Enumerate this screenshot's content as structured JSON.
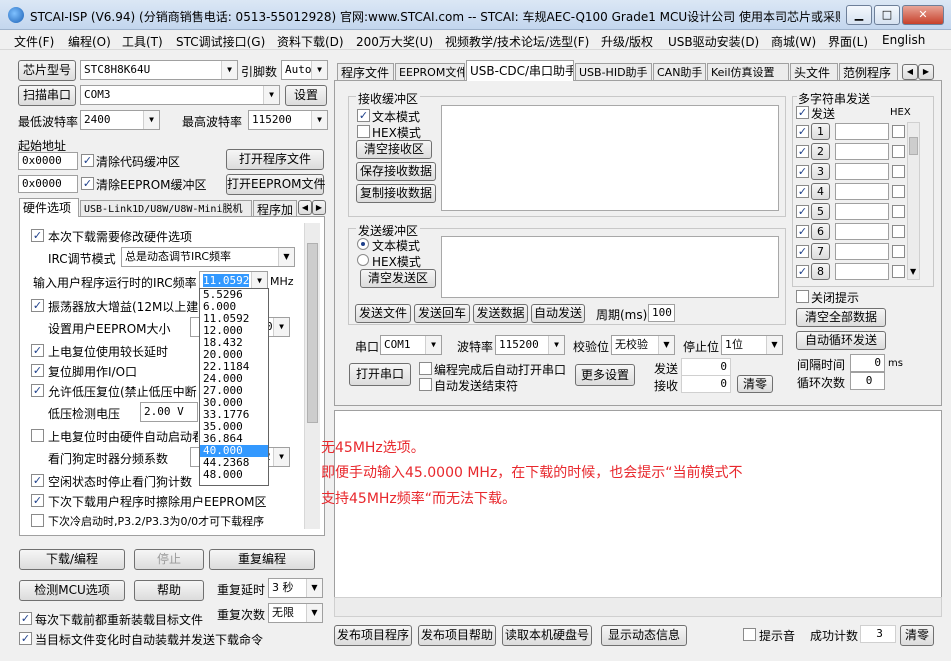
{
  "window": {
    "title": "STCAI-ISP (V6.94) (分销商销售电话: 0513-55012928) 官网:www.STCAI.com  -- STCAI: 车规AEC-Q100 Grade1 MCU设计公司 使用本司芯片或采购...",
    "min_glyph": "▁",
    "max_glyph": "□",
    "close_glyph": "✕"
  },
  "menu": [
    "文件(F)",
    "编程(O)",
    "工具(T)",
    "STC调试接口(G)",
    "资料下载(D)",
    "200万大奖(U)",
    "视频教学/技术论坛/选型(F)",
    "升级/版权",
    "USB驱动安装(D)",
    "商城(W)",
    "界面(L)",
    "English"
  ],
  "left": {
    "chip_model_btn": "芯片型号",
    "chip_model": "STC8H8K64U",
    "pin_label": "引脚数",
    "pin_value": "Auto",
    "scan_port_btn": "扫描串口",
    "port": "COM3",
    "settings_btn": "设置",
    "min_baud_label": "最低波特率",
    "min_baud": "2400",
    "max_baud_label": "最高波特率",
    "max_baud": "115200",
    "start_addr_label": "起始地址",
    "addr1": "0x0000",
    "clear_code_label": "清除代码缓冲区",
    "open_prog_btn": "打开程序文件",
    "addr2": "0x0000",
    "clear_eeprom_label": "清除EEPROM缓冲区",
    "open_eeprom_btn": "打开EEPROM文件",
    "tabs": [
      "硬件选项",
      "USB-Link1D/U8W/U8W-Mini脱机",
      "程序加"
    ],
    "hw": {
      "modify_hw": "本次下载需要修改硬件选项",
      "irc_mode_label": "IRC调节模式",
      "irc_mode": "总是动态调节IRC频率",
      "irc_freq_label": "输入用户程序运行时的IRC频率",
      "irc_freq_value": "11.0592",
      "mhz": "MHz",
      "osc_gain": "振荡器放大增益(12M以上建议",
      "eeprom_size_label": "设置用户EEPROM大小",
      "eeprom_size_value": "0",
      "long_delay": "上电复位使用较长延时",
      "reset_io": "复位脚用作I/O口",
      "lvd_reset": "允许低压复位(禁止低压中断",
      "lvd_label": "低压检测电压",
      "lvd_value": "2.00 V",
      "wdt_auto": "上电复位时由硬件自动启动看",
      "wdt_div_label": "看门狗定时器分频系数",
      "wdt_div_value": "2",
      "idle_wdt": "空闲状态时停止看门狗计数",
      "erase_eeprom": "下次下载用户程序时擦除用户EEPROM区",
      "cold_boot": "下次冷启动时,P3.2/P3.3为0/0才可下载程序"
    },
    "freq_options": [
      "5.5296",
      "6.000",
      "11.0592",
      "12.000",
      "18.432",
      "20.000",
      "22.1184",
      "24.000",
      "27.000",
      "30.000",
      "33.1776",
      "35.000",
      "36.864",
      "40.000",
      "44.2368",
      "48.000"
    ],
    "freq_selected_index": 13,
    "download_btn": "下载/编程",
    "stop_btn": "停止",
    "reprogram_btn": "重复编程",
    "detect_btn": "检测MCU选项",
    "help_btn": "帮助",
    "repeat_delay_label": "重复延时",
    "repeat_delay": "3 秒",
    "repeat_count_label": "重复次数",
    "repeat_count": "无限",
    "reload_label": "每次下载前都重新装载目标文件",
    "auto_send_label": "当目标文件变化时自动装载并发送下载命令"
  },
  "right": {
    "tabs": [
      "程序文件",
      "EEPROM文件",
      "USB-CDC/串口助手",
      "USB-HID助手",
      "CAN助手",
      "Keil仿真设置",
      "头文件",
      "范例程序"
    ],
    "recv_group": "接收缓冲区",
    "text_mode": "文本模式",
    "hex_mode": "HEX模式",
    "clear_recv": "清空接收区",
    "save_recv": "保存接收数据",
    "copy_recv": "复制接收数据",
    "send_group": "发送缓冲区",
    "clear_send": "清空发送区",
    "send_file": "发送文件",
    "send_back": "发送回车",
    "send_data": "发送数据",
    "auto_send": "自动发送",
    "period_label": "周期(ms)",
    "period": "100",
    "multi_group": "多字符串发送",
    "send_col": "发送",
    "hex_col": "HEX",
    "multi_rows": [
      "1",
      "2",
      "3",
      "4",
      "5",
      "6",
      "7",
      "8"
    ],
    "close_tip": "关闭提示",
    "clear_all": "清空全部数据",
    "auto_loop": "自动循环发送",
    "interval_label": "间隔时间",
    "interval": "0",
    "ms": "ms",
    "loop_count_label": "循环次数",
    "loop_count": "0",
    "port_label": "串口",
    "port": "COM1",
    "baud_label": "波特率",
    "baud": "115200",
    "parity_label": "校验位",
    "parity": "无校验",
    "stop_label": "停止位",
    "stop": "1位",
    "open_port": "打开串口",
    "auto_open": "编程完成后自动打开串口",
    "auto_end": "自动发送结束符",
    "more_settings": "更多设置",
    "send_count_label": "发送",
    "send_count": "0",
    "recv_count_label": "接收",
    "recv_count": "0",
    "clear_count": "清零"
  },
  "notes": [
    "无45MHz选项。",
    "即便手动输入45.0000 MHz，在下载的时候，也会提示“当前模式不",
    "支持45MHz频率“而无法下载。"
  ],
  "bottom": {
    "publish_prog": "发布项目程序",
    "publish_help": "发布项目帮助",
    "read_disk": "读取本机硬盘号",
    "show_dynamic": "显示动态信息",
    "beep": "提示音",
    "success_label": "成功计数",
    "success_count": "3",
    "clear": "清零"
  }
}
